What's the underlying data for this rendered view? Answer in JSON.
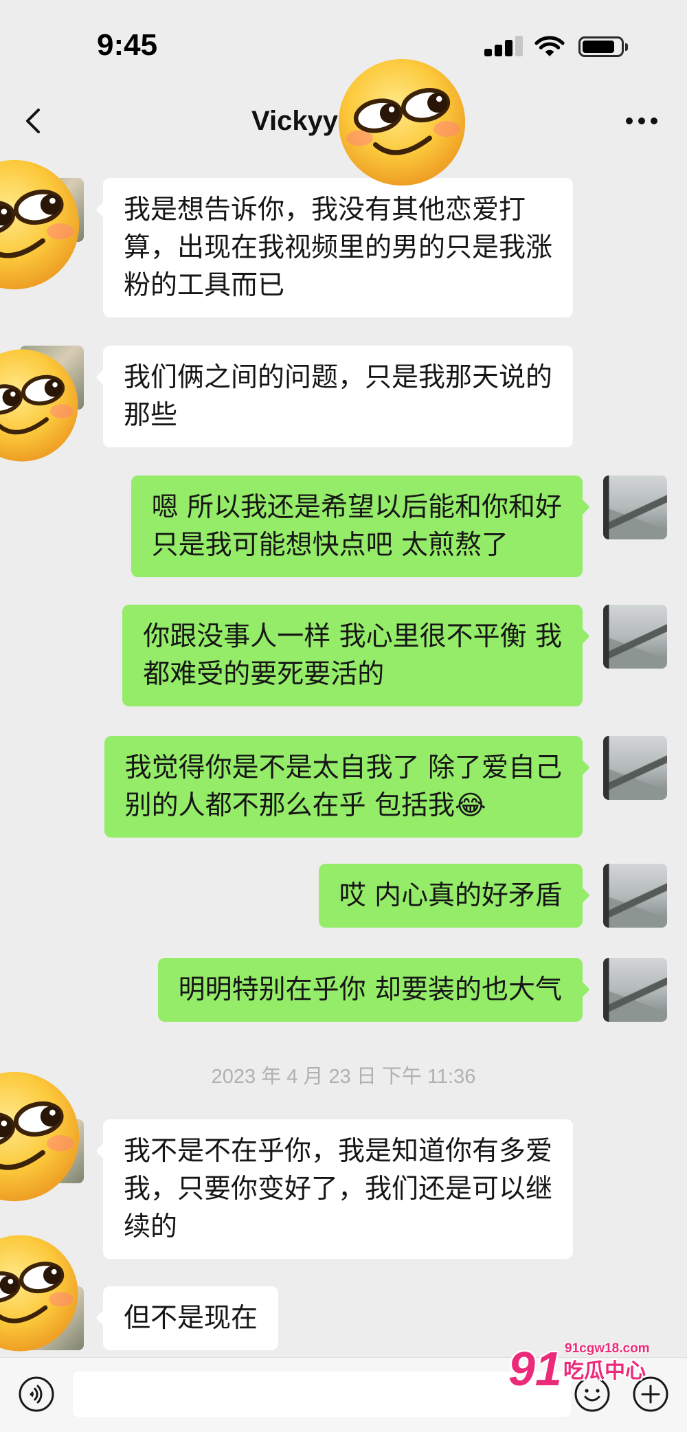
{
  "status_bar": {
    "time": "9:45",
    "signal_icon": "cellular-signal-icon",
    "wifi_icon": "wifi-icon",
    "battery_icon": "battery-icon",
    "battery_level": 0.85
  },
  "header": {
    "back_icon": "chevron-left-icon",
    "title": "Vickyy",
    "more_icon": "more-dots-icon"
  },
  "stickers": {
    "icon": "smirk-face-emoji"
  },
  "messages": [
    {
      "direction": "received",
      "lines": [
        "我是想告诉你，我没有其他恋爱打",
        "算，出现在我视频里的男的只是我涨",
        "粉的工具而已"
      ]
    },
    {
      "direction": "received",
      "lines": [
        "我们俩之间的问题，只是我那天说的",
        "那些"
      ]
    },
    {
      "direction": "sent",
      "lines": [
        "嗯 所以我还是希望以后能和你和好",
        "只是我可能想快点吧 太煎熬了"
      ]
    },
    {
      "direction": "sent",
      "lines": [
        "你跟没事人一样 我心里很不平衡 我",
        "都难受的要死要活的"
      ]
    },
    {
      "direction": "sent",
      "lines": [
        "我觉得你是不是太自我了 除了爱自己",
        "别的人都不那么在乎 包括我😂"
      ]
    },
    {
      "direction": "sent",
      "lines": [
        "哎 内心真的好矛盾"
      ]
    },
    {
      "direction": "sent",
      "lines": [
        "明明特别在乎你 却要装的也大气"
      ]
    },
    {
      "direction": "received",
      "lines": [
        "我不是不在乎你，我是知道你有多爱",
        "我，只要你变好了，我们还是可以继",
        "续的"
      ]
    },
    {
      "direction": "received",
      "lines": [
        "但不是现在"
      ]
    }
  ],
  "timestamp": "2023 年 4 月 23 日 下午 11:36",
  "input_bar": {
    "voice_icon": "voice-icon",
    "value": "",
    "emoji_icon": "emoji-icon",
    "plus_icon": "plus-icon"
  },
  "watermark": {
    "logo": "91",
    "site": "91cgw18.com",
    "name": "吃瓜中心"
  },
  "colors": {
    "background": "#ededed",
    "sent_bubble": "#95ec69",
    "received_bubble": "#ffffff",
    "timestamp_text": "#b0b0b0",
    "watermark": "#ec2a7a"
  }
}
